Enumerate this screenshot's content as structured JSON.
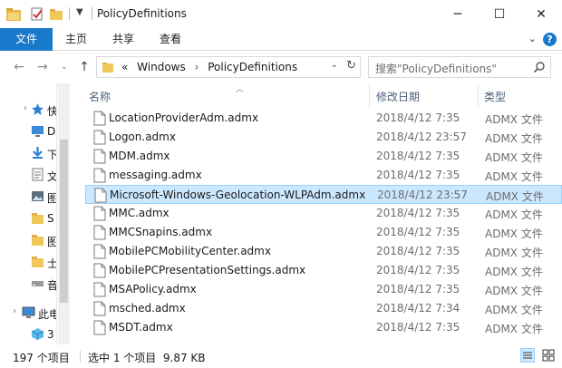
{
  "window": {
    "title": "PolicyDefinitions",
    "controls": {
      "minimize": "─",
      "maximize": "☐",
      "close": "✕"
    }
  },
  "ribbon": {
    "tabs": [
      {
        "label": "文件",
        "active": true
      },
      {
        "label": "主页"
      },
      {
        "label": "共享"
      },
      {
        "label": "查看"
      }
    ],
    "expand": "⌄",
    "help": "?"
  },
  "nav": {
    "back": "←",
    "forward": "→",
    "recent": "⌄",
    "up": "↑"
  },
  "address": {
    "prefix": "«",
    "crumbs": [
      "Windows",
      "PolicyDefinitions"
    ],
    "separator": "›",
    "refresh": "↻",
    "dropdown": "⌄"
  },
  "search": {
    "placeholder": "搜索\"PolicyDefinitions\""
  },
  "navpane": {
    "items": [
      {
        "label": "快速",
        "icon": "star-icon",
        "expander": "›"
      },
      {
        "label": "D",
        "icon": "desktop-icon"
      },
      {
        "label": "下",
        "icon": "download-icon"
      },
      {
        "label": "文",
        "icon": "document-icon"
      },
      {
        "label": "图",
        "icon": "picture-icon"
      },
      {
        "label": "S",
        "icon": "folder-icon"
      },
      {
        "label": "图",
        "icon": "folder-icon"
      },
      {
        "label": "士",
        "icon": "folder-icon"
      },
      {
        "label": "音",
        "icon": "drive-icon"
      },
      {
        "label": "此电",
        "icon": "computer-icon",
        "expander": "›"
      },
      {
        "label": "3",
        "icon": "3d-objects-icon"
      }
    ]
  },
  "columns": {
    "name": "名称",
    "date": "修改日期",
    "type": "类型"
  },
  "files": [
    {
      "name": "LocationProviderAdm.admx",
      "date": "2018/4/12 7:35",
      "type": "ADMX 文件"
    },
    {
      "name": "Logon.admx",
      "date": "2018/4/12 23:57",
      "type": "ADMX 文件"
    },
    {
      "name": "MDM.admx",
      "date": "2018/4/12 7:35",
      "type": "ADMX 文件"
    },
    {
      "name": "messaging.admx",
      "date": "2018/4/12 7:35",
      "type": "ADMX 文件"
    },
    {
      "name": "Microsoft-Windows-Geolocation-WLPAdm.admx",
      "date": "2018/4/12 23:57",
      "type": "ADMX 文件",
      "selected": true
    },
    {
      "name": "MMC.admx",
      "date": "2018/4/12 7:35",
      "type": "ADMX 文件"
    },
    {
      "name": "MMCSnapins.admx",
      "date": "2018/4/12 7:35",
      "type": "ADMX 文件"
    },
    {
      "name": "MobilePCMobilityCenter.admx",
      "date": "2018/4/12 7:35",
      "type": "ADMX 文件"
    },
    {
      "name": "MobilePCPresentationSettings.admx",
      "date": "2018/4/12 7:35",
      "type": "ADMX 文件"
    },
    {
      "name": "MSAPolicy.admx",
      "date": "2018/4/12 7:35",
      "type": "ADMX 文件"
    },
    {
      "name": "msched.admx",
      "date": "2018/4/12 7:34",
      "type": "ADMX 文件"
    },
    {
      "name": "MSDT.admx",
      "date": "2018/4/12 7:35",
      "type": "ADMX 文件"
    }
  ],
  "status": {
    "count": "197 个项目",
    "selection": "选中 1 个项目  9.87 KB"
  },
  "colors": {
    "accent": "#1979ca",
    "selection": "#cce8ff",
    "selection_border": "#99d1ff"
  }
}
